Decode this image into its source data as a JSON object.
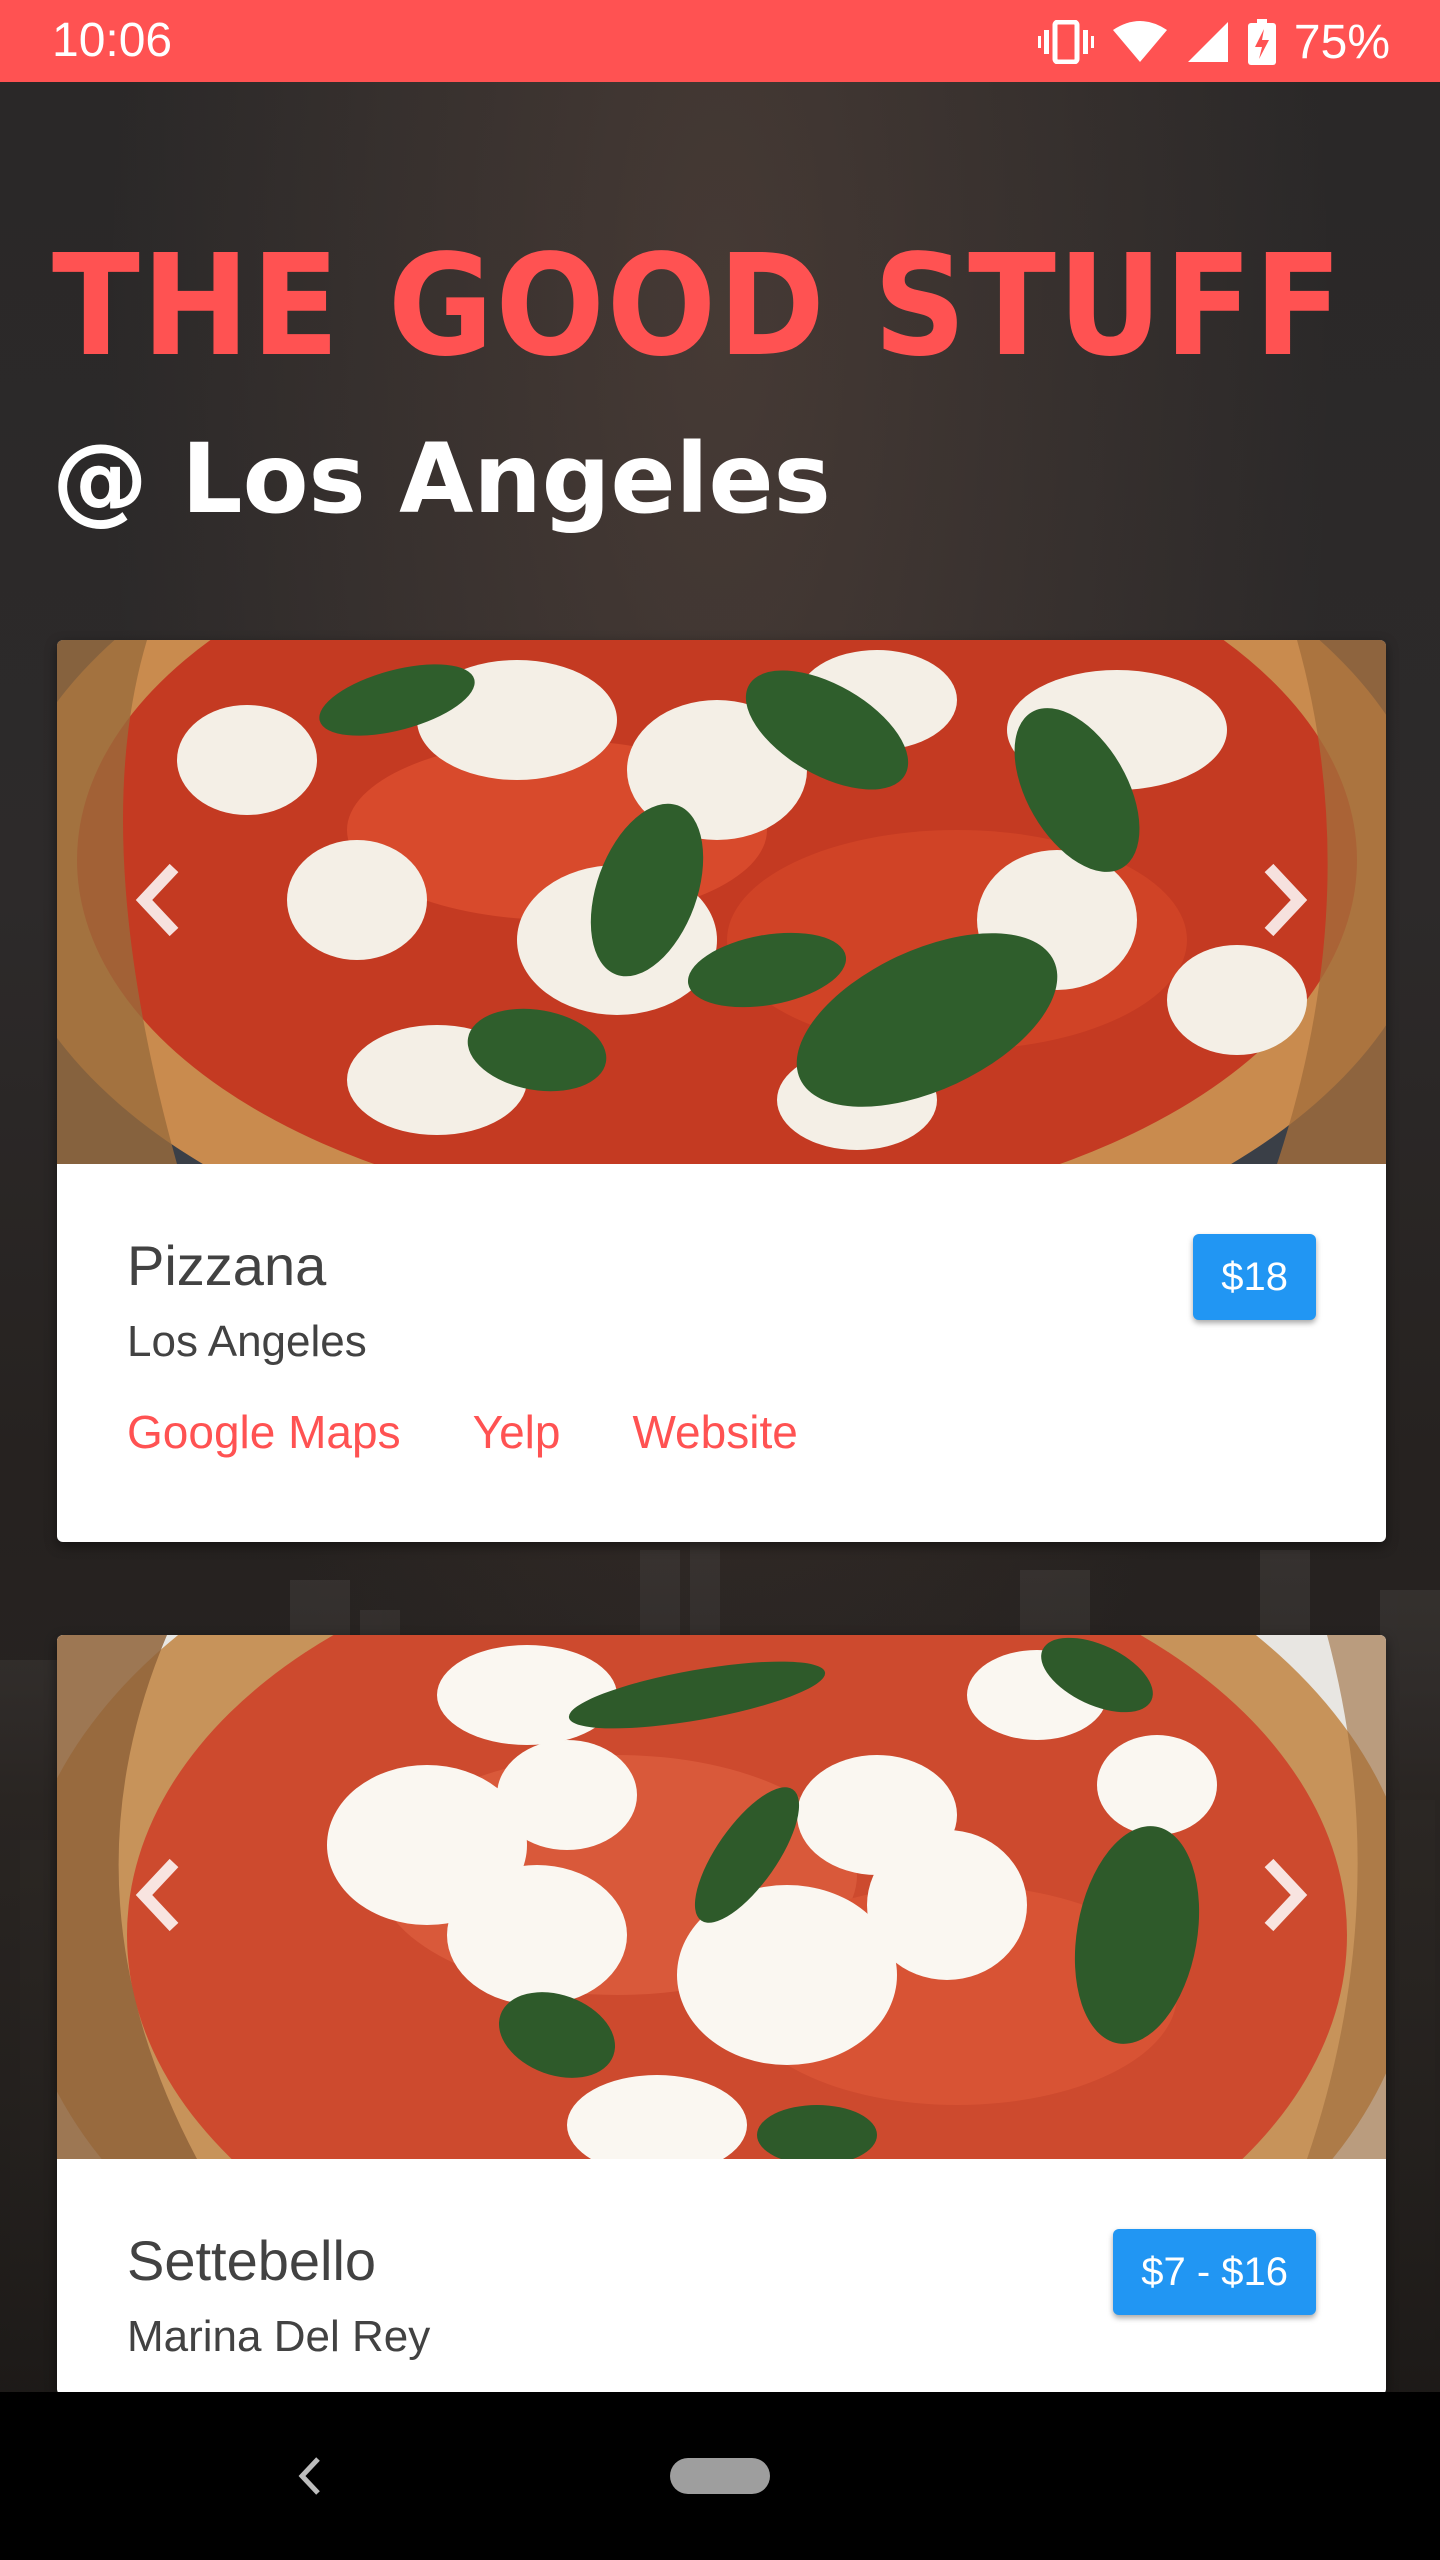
{
  "status_bar": {
    "time": "10:06",
    "battery": "75%",
    "icons": [
      "vibrate-icon",
      "wifi-icon",
      "cell-signal-icon",
      "battery-charging-icon"
    ]
  },
  "header": {
    "title": "THE GOOD STUFF",
    "subtitle": "@ Los Angeles"
  },
  "colors": {
    "accent": "#ff5252",
    "price_badge": "#2196f3",
    "text": "#424242"
  },
  "restaurants": [
    {
      "name": "Pizzana",
      "location": "Los Angeles",
      "price": "$18",
      "links": [
        "Google Maps",
        "Yelp",
        "Website"
      ]
    },
    {
      "name": "Settebello",
      "location": "Marina Del Rey",
      "price": "$7 - $16"
    }
  ],
  "nav_bar": {
    "icons": [
      "back-icon",
      "home-pill-icon"
    ]
  }
}
